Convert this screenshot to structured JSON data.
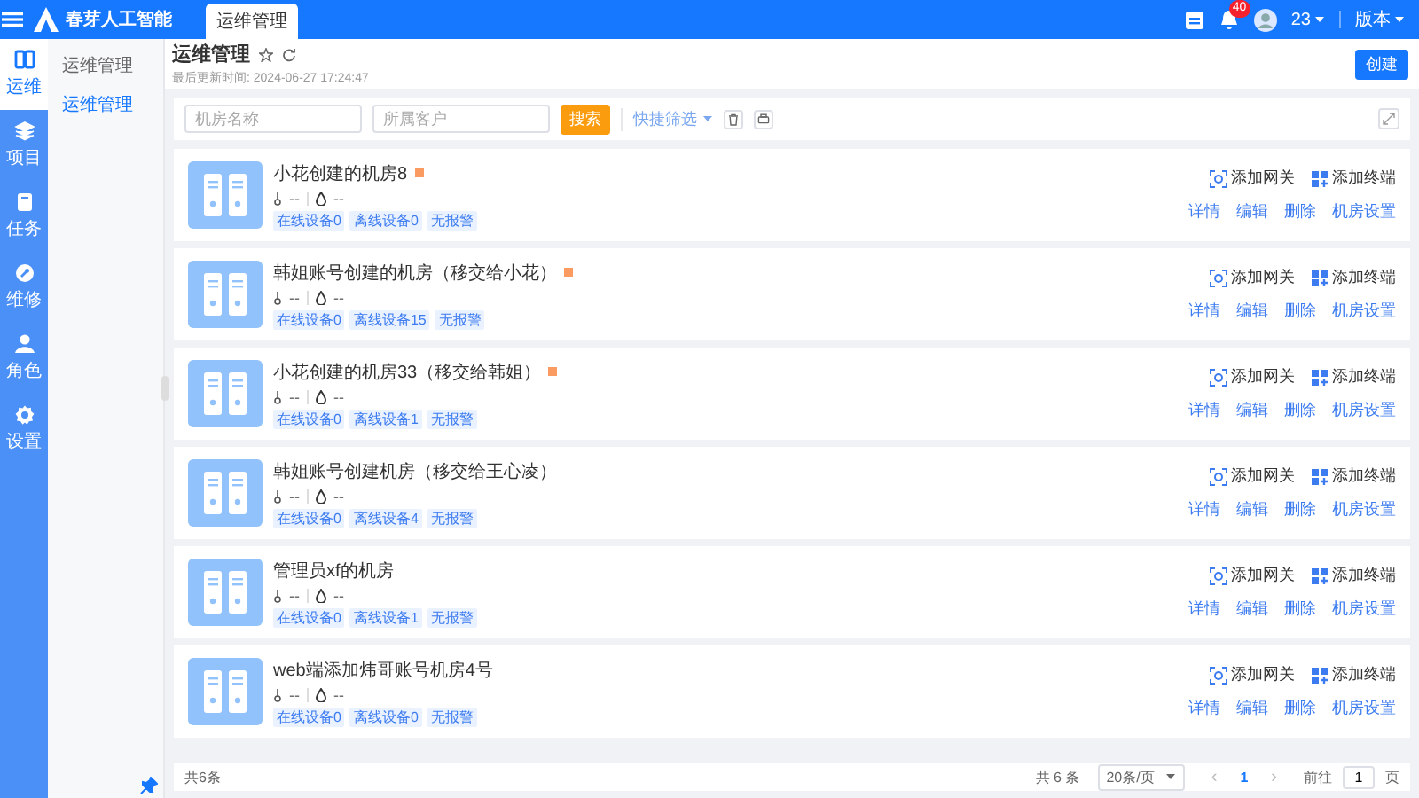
{
  "header": {
    "logo_text": "春芽人工智能",
    "tabs": [
      {
        "label": "运维管理",
        "selected": true
      }
    ],
    "notification_count": "40",
    "user": "23",
    "version_menu": "版本"
  },
  "rail": {
    "items": [
      {
        "label": "运维",
        "selected": true
      },
      {
        "label": "项目",
        "selected": false
      },
      {
        "label": "任务",
        "selected": false
      },
      {
        "label": "维修",
        "selected": false
      },
      {
        "label": "角色",
        "selected": false
      },
      {
        "label": "设置",
        "selected": false
      }
    ]
  },
  "submenu": {
    "group": "运维管理",
    "items": [
      {
        "label": "运维管理",
        "selected": true
      }
    ]
  },
  "page": {
    "title": "运维管理",
    "updated": "最后更新时间: 2024-06-27 17:24:47",
    "create_button": "创建"
  },
  "filters": {
    "fields": [
      {
        "placeholder": "机房名称"
      },
      {
        "placeholder": "所属客户"
      }
    ],
    "search_button": "搜索",
    "quick_filter": "快捷筛选"
  },
  "rooms": [
    {
      "name": "小花创建的机房8",
      "flagged": true,
      "stat_1": "--",
      "stat_2": "--",
      "tags": [
        "在线设备0",
        "离线设备0",
        "无报警"
      ],
      "actions": [
        "添加网关",
        "添加终端"
      ],
      "links": [
        "详情",
        "编辑",
        "删除",
        "机房设置"
      ]
    },
    {
      "name": "韩姐账号创建的机房（移交给小花）",
      "flagged": true,
      "stat_1": "--",
      "stat_2": "--",
      "tags": [
        "在线设备0",
        "离线设备15",
        "无报警"
      ],
      "actions": [
        "添加网关",
        "添加终端"
      ],
      "links": [
        "详情",
        "编辑",
        "删除",
        "机房设置"
      ]
    },
    {
      "name": "小花创建的机房33（移交给韩姐）",
      "flagged": true,
      "stat_1": "--",
      "stat_2": "--",
      "tags": [
        "在线设备0",
        "离线设备1",
        "无报警"
      ],
      "actions": [
        "添加网关",
        "添加终端"
      ],
      "links": [
        "详情",
        "编辑",
        "删除",
        "机房设置"
      ]
    },
    {
      "name": "韩姐账号创建机房（移交给王心凌）",
      "flagged": false,
      "stat_1": "--",
      "stat_2": "--",
      "tags": [
        "在线设备0",
        "离线设备4",
        "无报警"
      ],
      "actions": [
        "添加网关",
        "添加终端"
      ],
      "links": [
        "详情",
        "编辑",
        "删除",
        "机房设置"
      ]
    },
    {
      "name": "管理员xf的机房",
      "flagged": false,
      "stat_1": "--",
      "stat_2": "--",
      "tags": [
        "在线设备0",
        "离线设备1",
        "无报警"
      ],
      "actions": [
        "添加网关",
        "添加终端"
      ],
      "links": [
        "详情",
        "编辑",
        "删除",
        "机房设置"
      ]
    },
    {
      "name": "web端添加炜哥账号机房4号",
      "flagged": false,
      "stat_1": "--",
      "stat_2": "--",
      "tags": [
        "在线设备0",
        "离线设备0",
        "无报警"
      ],
      "actions": [
        "添加网关",
        "添加终端"
      ],
      "links": [
        "详情",
        "编辑",
        "删除",
        "机房设置"
      ]
    }
  ],
  "pager": {
    "summary": "共6条",
    "total": "共 6 条",
    "page_size": "20条/页",
    "prev": "‹",
    "current": "1",
    "next": "›",
    "goto": "前往",
    "goto_value": "1",
    "page_unit": "页"
  }
}
